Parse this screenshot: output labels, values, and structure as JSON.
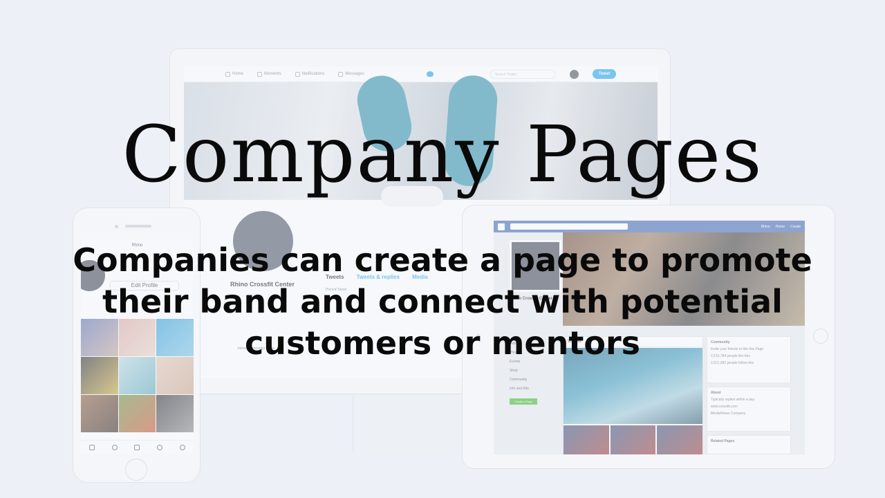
{
  "slide": {
    "title": "Company Pages",
    "subtitle": "Companies can create a page to promote their band and connect with potential customers or mentors"
  },
  "colors": {
    "background": "#edf0f7",
    "text": "#0a0a0a",
    "twitter_blue": "#1da1f2",
    "facebook_blue": "#4267b2"
  },
  "desktop_mockup": {
    "nav": {
      "home": "Home",
      "moments": "Moments",
      "notifications": "Notifications",
      "messages": "Messages",
      "search_placeholder": "Search Twitter",
      "tweet_button": "Tweet"
    },
    "profile_name": "Rhino Crossfit Center",
    "tabs": [
      "Tweets",
      "Tweets & replies",
      "Media"
    ],
    "pinned": "Pinned Tweet",
    "joined": "Joined September 2014"
  },
  "phone_mockup": {
    "username": "Rhino",
    "edit_profile": "Edit Profile"
  },
  "tablet_mockup": {
    "nav_user": "Rhino",
    "nav_home": "Home",
    "nav_create": "Create",
    "page_name": "Rhino Crossfit Center",
    "side_links": [
      "Videos",
      "Photos",
      "Events",
      "Shop",
      "Community",
      "Info and Ads"
    ],
    "create_page": "Create a Page",
    "videos_title": "Videos",
    "community_title": "Community",
    "community_lines": [
      "Invite your friends to like this Page",
      "2,515,784 people like this",
      "2,621,982 people follow this"
    ],
    "about_title": "About",
    "about_lines": [
      "Typically replies within a day",
      "www.crossfit.com",
      "Media/News Company"
    ],
    "related_title": "Related Pages"
  }
}
